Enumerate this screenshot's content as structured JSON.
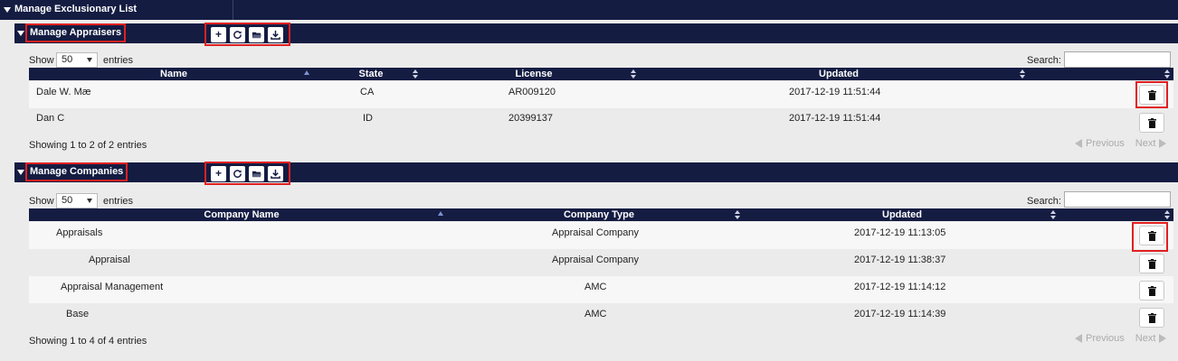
{
  "header": {
    "title": "Manage Exclusionary List"
  },
  "appraisers": {
    "title": "Manage Appraisers",
    "toolbar": {
      "add": "+",
      "refresh": "refresh",
      "open": "open",
      "download": "download"
    },
    "show_label": "Show",
    "page_size": "50",
    "entries_label": "entries",
    "search_label": "Search:",
    "search_value": "",
    "columns": [
      "Name",
      "State",
      "License",
      "Updated"
    ],
    "rows": [
      {
        "name": "Dale W. Mæ",
        "state": "CA",
        "license": "AR009120",
        "updated": "2017-12-19 11:51:44"
      },
      {
        "name": "Dan C",
        "state": "ID",
        "license": "20399137",
        "updated": "2017-12-19 11:51:44"
      }
    ],
    "info": "Showing 1 to 2 of 2 entries",
    "prev": "Previous",
    "next": "Next"
  },
  "companies": {
    "title": "Manage Companies",
    "show_label": "Show",
    "page_size": "50",
    "entries_label": "entries",
    "search_label": "Search:",
    "search_value": "",
    "columns": [
      "Company Name",
      "Company Type",
      "Updated"
    ],
    "rows": [
      {
        "name": "Appraisals",
        "type": "Appraisal Company",
        "updated": "2017-12-19 11:13:05"
      },
      {
        "name": "Appraisal",
        "type": "Appraisal Company",
        "updated": "2017-12-19 11:38:37"
      },
      {
        "name": "Appraisal Management",
        "type": "AMC",
        "updated": "2017-12-19 11:14:12"
      },
      {
        "name": "Base",
        "type": "AMC",
        "updated": "2017-12-19 11:14:39"
      }
    ],
    "info": "Showing 1 to 4 of 4 entries",
    "prev": "Previous",
    "next": "Next"
  },
  "colors": {
    "header_navy": "#141c42",
    "highlight_red": "#e02020",
    "row_light": "#f7f7f7",
    "row_dark": "#ebebeb"
  },
  "icons": [
    "caret-down-icon",
    "plus-icon",
    "refresh-icon",
    "folder-open-icon",
    "download-icon",
    "trash-icon",
    "sort-icon",
    "chevron-left-icon",
    "chevron-right-icon"
  ]
}
